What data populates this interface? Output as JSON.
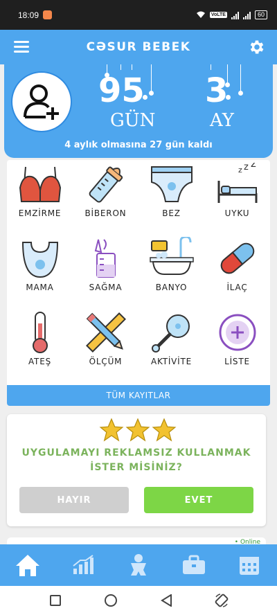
{
  "status_bar": {
    "time": "18:09",
    "volte": "VoLTE",
    "battery": "60"
  },
  "app": {
    "title": "CƏSUR BEBEK"
  },
  "baby": {
    "days_value": "95",
    "days_label": "GÜN",
    "months_value": "3",
    "months_label": "AY",
    "remaining_text": "4 aylık olmasına 27 gün kaldı"
  },
  "activities": [
    {
      "label": "EMZİRME",
      "icon": "bra-icon"
    },
    {
      "label": "BİBERON",
      "icon": "bottle-icon"
    },
    {
      "label": "BEZ",
      "icon": "diaper-icon"
    },
    {
      "label": "UYKU",
      "icon": "sleep-icon"
    },
    {
      "label": "MAMA",
      "icon": "bib-icon"
    },
    {
      "label": "SAĞMA",
      "icon": "breast-pump-icon"
    },
    {
      "label": "BANYO",
      "icon": "bathtub-icon"
    },
    {
      "label": "İLAÇ",
      "icon": "pill-icon"
    },
    {
      "label": "ATEŞ",
      "icon": "thermometer-icon"
    },
    {
      "label": "ÖLÇÜM",
      "icon": "ruler-pencil-icon"
    },
    {
      "label": "AKTİVİTE",
      "icon": "rattle-icon"
    },
    {
      "label": "LİSTE",
      "icon": "plus-circle-icon"
    }
  ],
  "all_records_label": "TÜM KAYITLAR",
  "ad_prompt": {
    "question": "UYGULAMAYI REKLAMSIZ KULLANMAK İSTER MİSİNİZ?",
    "no_label": "HAYIR",
    "yes_label": "EVET",
    "star_count": 3
  },
  "peek": {
    "online_label": "• Online"
  },
  "colors": {
    "primary": "#4ea6ee",
    "accent_green": "#7dd646",
    "question_green": "#7bb35c",
    "no_gray": "#cfcfcf"
  },
  "bottom_nav": [
    "home-icon",
    "chart-icon",
    "baby-icon",
    "briefcase-icon",
    "calendar-icon"
  ]
}
